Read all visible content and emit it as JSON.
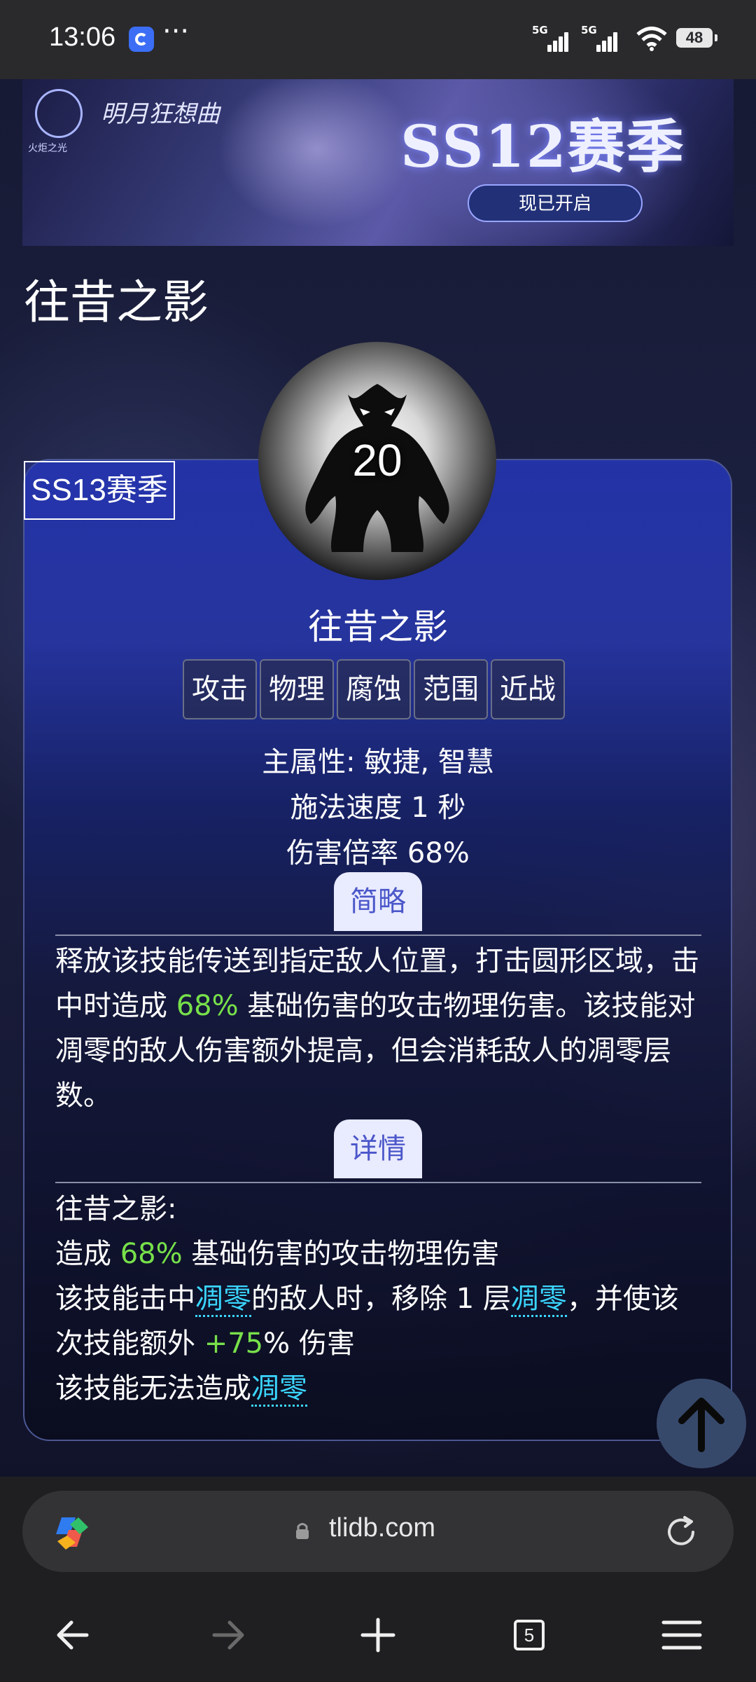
{
  "status_bar": {
    "time": "13:06",
    "more": "···",
    "network1": "5G",
    "network2": "5G",
    "battery": "48"
  },
  "banner": {
    "logo_text": "火炬之光",
    "subtitle": "明月狂想曲",
    "title": "SS12赛季",
    "button": "现已开启"
  },
  "page": {
    "title": "往昔之影"
  },
  "card": {
    "season_badge": "SS13赛季",
    "skill_level": "20",
    "skill_name": "往昔之影",
    "tags": [
      "攻击",
      "物理",
      "腐蚀",
      "范围",
      "近战"
    ],
    "main_attr": "主属性:   敏捷, 智慧",
    "cast_speed": "施法速度 1 秒",
    "damage_rate": "伤害倍率 68%",
    "summary_button": "简略",
    "summary": {
      "part1": "释放该技能传送到指定敌人位置，打击圆形区域，击中时造成 ",
      "highlight": "68%",
      "part2": " 基础伤害的攻击物理伤害。该技能对凋零的敌人伤害额外提高，但会消耗敌人的凋零层数。"
    },
    "detail_button": "详情",
    "detail": {
      "heading": "往昔之影:",
      "line2_pre": "造成 ",
      "line2_hl": "68%",
      "line2_post": " 基础伤害的攻击物理伤害",
      "line3_a": "该技能击中",
      "keyword": "凋零",
      "line3_b": "的敌人时，移除 1 层",
      "line3_c": "，并使该次技能额外 ",
      "line3_hl": "+75",
      "line3_d": "% 伤害",
      "line4_a": "该技能无法造成"
    }
  },
  "browser": {
    "url": "tlidb.com",
    "tab_count": "5"
  },
  "colors": {
    "accent_green": "#77e04a",
    "keyword_cyan": "#3bd6ff",
    "card_blue": "#2333a6"
  }
}
